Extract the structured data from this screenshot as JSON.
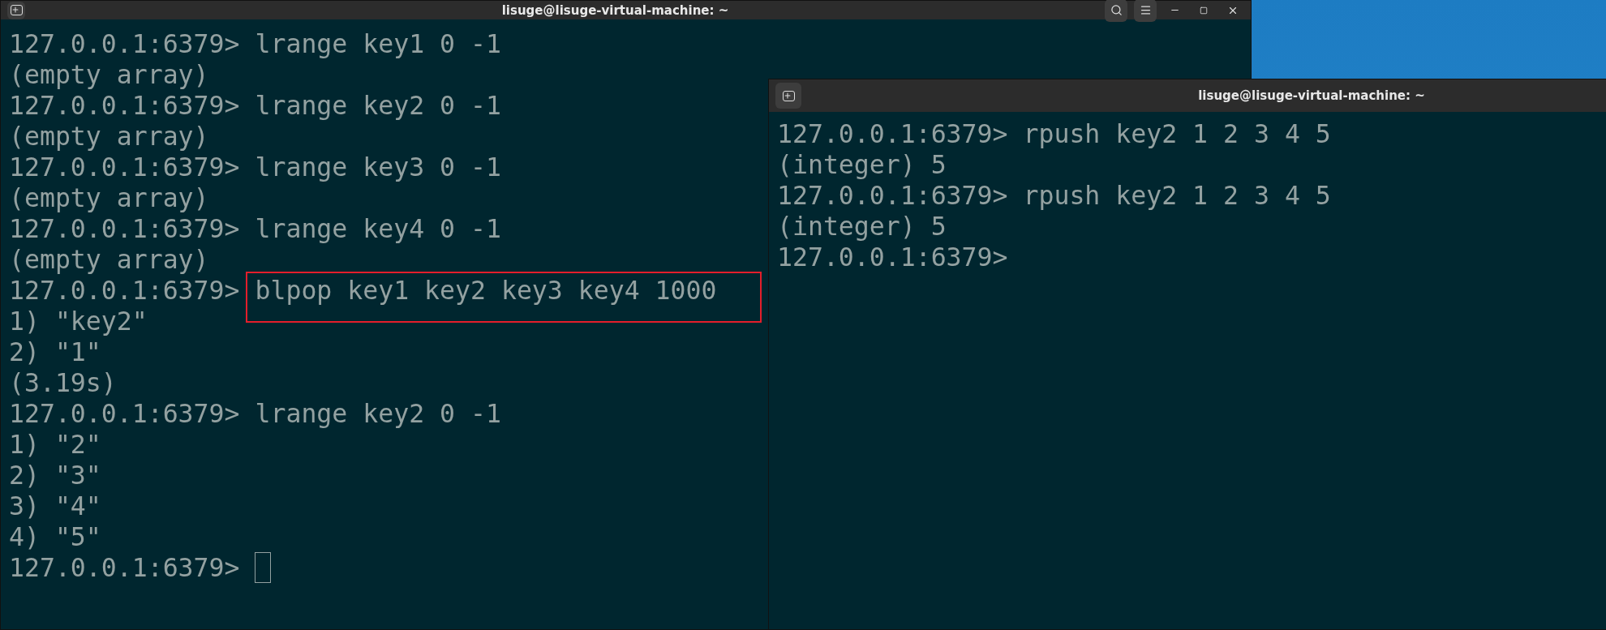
{
  "left_window": {
    "title": "lisuge@lisuge-virtual-machine: ~",
    "lines": [
      {
        "kind": "input",
        "prompt": "127.0.0.1:6379>",
        "command": "lrange key1 0 -1",
        "highlighted": false,
        "cursor": false
      },
      {
        "kind": "output",
        "text": "(empty array)"
      },
      {
        "kind": "input",
        "prompt": "127.0.0.1:6379>",
        "command": "lrange key2 0 -1",
        "highlighted": false,
        "cursor": false
      },
      {
        "kind": "output",
        "text": "(empty array)"
      },
      {
        "kind": "input",
        "prompt": "127.0.0.1:6379>",
        "command": "lrange key3 0 -1",
        "highlighted": false,
        "cursor": false
      },
      {
        "kind": "output",
        "text": "(empty array)"
      },
      {
        "kind": "input",
        "prompt": "127.0.0.1:6379>",
        "command": "lrange key4 0 -1",
        "highlighted": false,
        "cursor": false
      },
      {
        "kind": "output",
        "text": "(empty array)"
      },
      {
        "kind": "input",
        "prompt": "127.0.0.1:6379>",
        "command": "blpop key1 key2 key3 key4 1000",
        "highlighted": true,
        "cursor": false
      },
      {
        "kind": "output",
        "text": "1) \"key2\""
      },
      {
        "kind": "output",
        "text": "2) \"1\""
      },
      {
        "kind": "output",
        "text": "(3.19s)"
      },
      {
        "kind": "input",
        "prompt": "127.0.0.1:6379>",
        "command": "lrange key2 0 -1",
        "highlighted": false,
        "cursor": false
      },
      {
        "kind": "output",
        "text": "1) \"2\""
      },
      {
        "kind": "output",
        "text": "2) \"3\""
      },
      {
        "kind": "output",
        "text": "3) \"4\""
      },
      {
        "kind": "output",
        "text": "4) \"5\""
      },
      {
        "kind": "input",
        "prompt": "127.0.0.1:6379>",
        "highlighted": false,
        "cursor": true
      }
    ]
  },
  "right_window": {
    "title": "lisuge@lisuge-virtual-machine: ~",
    "lines": [
      {
        "kind": "input",
        "prompt": "127.0.0.1:6379>",
        "command": "rpush key2 1 2 3 4 5",
        "highlighted": false,
        "cursor": false
      },
      {
        "kind": "output",
        "text": "(integer) 5"
      },
      {
        "kind": "input",
        "prompt": "127.0.0.1:6379>",
        "command": "rpush key2 1 2 3 4 5",
        "highlighted": false,
        "cursor": false
      },
      {
        "kind": "output",
        "text": "(integer) 5"
      },
      {
        "kind": "input",
        "prompt": "127.0.0.1:6379>",
        "highlighted": false,
        "cursor": false
      }
    ]
  }
}
